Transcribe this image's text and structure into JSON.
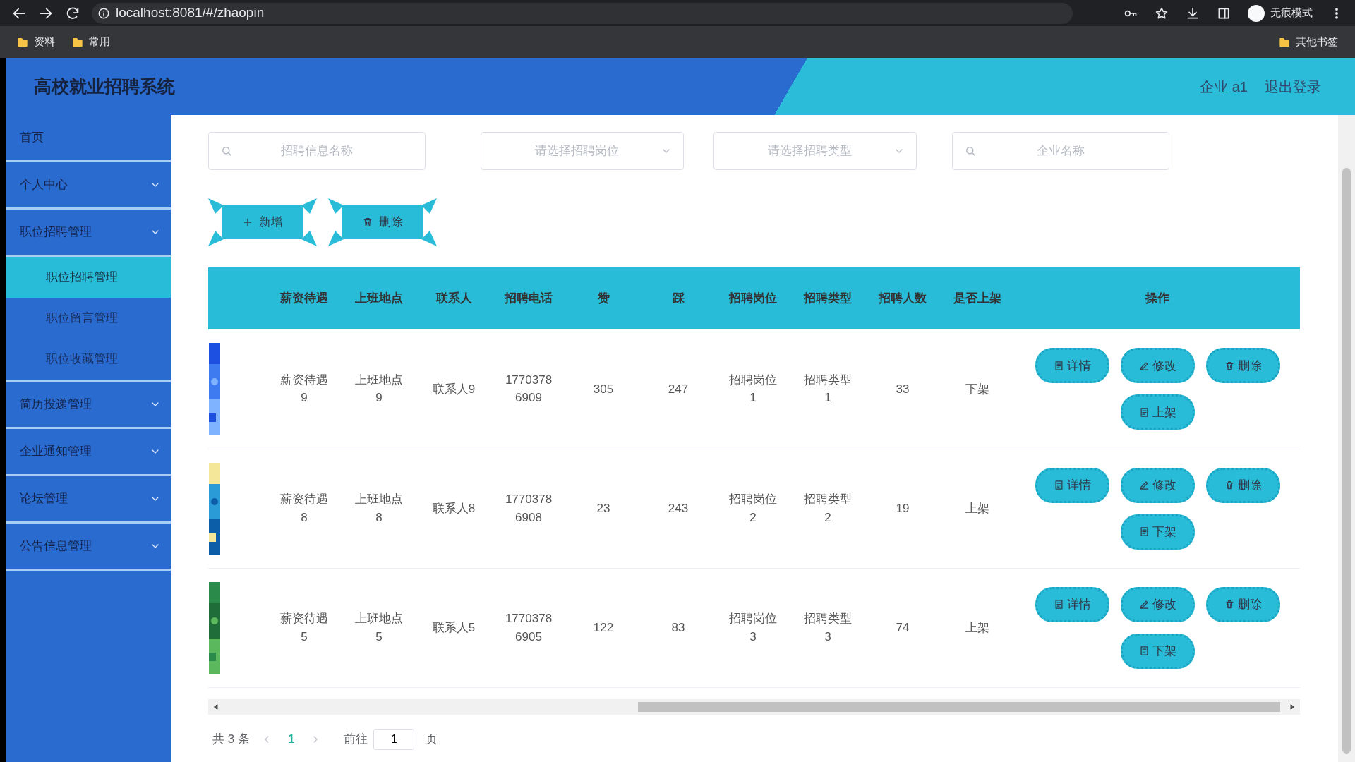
{
  "browser": {
    "url": "localhost:8081/#/zhaopin",
    "profile_label": "无痕模式",
    "bookmarks": [
      {
        "label": "资料"
      },
      {
        "label": "常用"
      }
    ],
    "other_bookmarks": "其他书签"
  },
  "app": {
    "title": "高校就业招聘系统",
    "user": "企业 a1",
    "logout": "退出登录"
  },
  "sidebar": {
    "items": [
      {
        "label": "首页",
        "expandable": false
      },
      {
        "label": "个人中心",
        "expandable": true
      },
      {
        "label": "职位招聘管理",
        "expandable": true,
        "children": [
          {
            "label": "职位招聘管理",
            "selected": true
          },
          {
            "label": "职位留言管理",
            "selected": false
          },
          {
            "label": "职位收藏管理",
            "selected": false
          }
        ]
      },
      {
        "label": "简历投递管理",
        "expandable": true
      },
      {
        "label": "企业通知管理",
        "expandable": true
      },
      {
        "label": "论坛管理",
        "expandable": true
      },
      {
        "label": "公告信息管理",
        "expandable": true
      }
    ]
  },
  "filters": [
    {
      "kind": "search",
      "placeholder": "招聘信息名称"
    },
    {
      "kind": "select",
      "placeholder": "请选择招聘岗位"
    },
    {
      "kind": "select",
      "placeholder": "请选择招聘类型"
    },
    {
      "kind": "search",
      "placeholder": "企业名称"
    }
  ],
  "actions": [
    {
      "kind": "add",
      "label": "新增"
    },
    {
      "kind": "delete",
      "label": "删除"
    }
  ],
  "table": {
    "columns": [
      "薪资待遇",
      "上班地点",
      "联系人",
      "招聘电话",
      "赞",
      "踩",
      "招聘岗位",
      "招聘类型",
      "招聘人数",
      "是否上架",
      "操作"
    ],
    "rows": [
      {
        "cells": [
          "薪资待遇9",
          "上班地点9",
          "联系人9",
          "17703786909",
          "305",
          "247",
          "招聘岗位1",
          "招聘类型1",
          "33",
          "下架"
        ],
        "buttons": [
          {
            "kind": "detail",
            "label": "详情"
          },
          {
            "kind": "edit",
            "label": "修改"
          },
          {
            "kind": "delete",
            "label": "删除"
          },
          {
            "kind": "detail",
            "label": "上架"
          }
        ]
      },
      {
        "cells": [
          "薪资待遇8",
          "上班地点8",
          "联系人8",
          "17703786908",
          "23",
          "243",
          "招聘岗位2",
          "招聘类型2",
          "19",
          "上架"
        ],
        "buttons": [
          {
            "kind": "detail",
            "label": "详情"
          },
          {
            "kind": "edit",
            "label": "修改"
          },
          {
            "kind": "delete",
            "label": "删除"
          },
          {
            "kind": "detail",
            "label": "下架"
          }
        ]
      },
      {
        "cells": [
          "薪资待遇5",
          "上班地点5",
          "联系人5",
          "17703786905",
          "122",
          "83",
          "招聘岗位3",
          "招聘类型3",
          "74",
          "上架"
        ],
        "buttons": [
          {
            "kind": "detail",
            "label": "详情"
          },
          {
            "kind": "edit",
            "label": "修改"
          },
          {
            "kind": "delete",
            "label": "删除"
          },
          {
            "kind": "detail",
            "label": "下架"
          }
        ]
      }
    ]
  },
  "pagination": {
    "total": "共 3 条",
    "pages": [
      {
        "label": "1",
        "selected": true
      }
    ],
    "goto_label": "前往",
    "goto_value": "1",
    "page_suffix": "页"
  }
}
